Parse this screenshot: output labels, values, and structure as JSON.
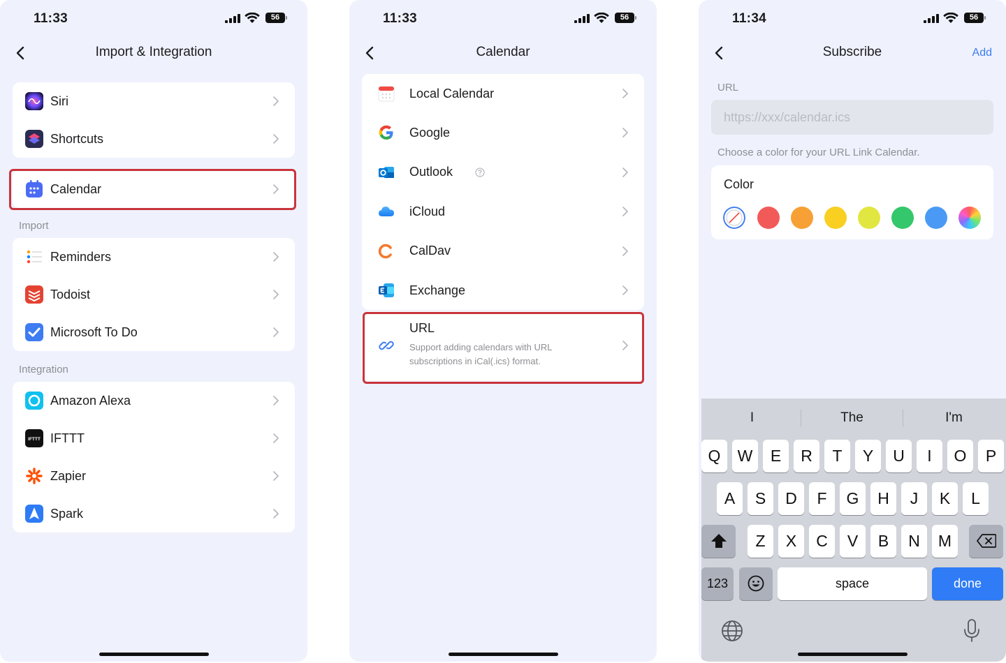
{
  "panel1": {
    "time": "11:33",
    "battery": "56",
    "title": "Import & Integration",
    "group_top": [
      {
        "label": "Siri",
        "icon": "siri-icon"
      },
      {
        "label": "Shortcuts",
        "icon": "shortcuts-icon"
      }
    ],
    "calendar": {
      "label": "Calendar",
      "icon": "calendar-icon"
    },
    "import_header": "Import",
    "import_items": [
      {
        "label": "Reminders",
        "icon": "reminders-icon"
      },
      {
        "label": "Todoist",
        "icon": "todoist-icon"
      },
      {
        "label": "Microsoft To Do",
        "icon": "microsoft-todo-icon"
      }
    ],
    "integration_header": "Integration",
    "integration_items": [
      {
        "label": "Amazon Alexa",
        "icon": "alexa-icon"
      },
      {
        "label": "IFTTT",
        "icon": "ifttt-icon"
      },
      {
        "label": "Zapier",
        "icon": "zapier-icon"
      },
      {
        "label": "Spark",
        "icon": "spark-icon"
      }
    ],
    "ifttt_logo_text": "IFTTT"
  },
  "panel2": {
    "time": "11:33",
    "battery": "56",
    "title": "Calendar",
    "items": [
      {
        "label": "Local Calendar",
        "icon": "local-calendar-icon"
      },
      {
        "label": "Google",
        "icon": "google-icon"
      },
      {
        "label": "Outlook",
        "icon": "outlook-icon"
      },
      {
        "label": "iCloud",
        "icon": "icloud-icon"
      },
      {
        "label": "CalDav",
        "icon": "caldav-icon"
      },
      {
        "label": "Exchange",
        "icon": "exchange-icon"
      }
    ],
    "url_item": {
      "label": "URL",
      "description": "Support adding calendars with URL subscriptions in iCal(.ics) format.",
      "icon": "link-icon"
    }
  },
  "panel3": {
    "time": "11:34",
    "battery": "56",
    "title": "Subscribe",
    "add_label": "Add",
    "url_label": "URL",
    "url_placeholder": "https://xxx/calendar.ics",
    "url_value": "",
    "color_hint": "Choose a color for your URL Link Calendar.",
    "color_label": "Color",
    "colors": [
      "none",
      "#f25a5a",
      "#f7a035",
      "#f9cf22",
      "#e2e640",
      "#34c76b",
      "#4a9af5",
      "rainbow"
    ],
    "keyboard": {
      "suggestions": [
        "I",
        "The",
        "I'm"
      ],
      "row1": [
        "Q",
        "W",
        "E",
        "R",
        "T",
        "Y",
        "U",
        "I",
        "O",
        "P"
      ],
      "row2": [
        "A",
        "S",
        "D",
        "F",
        "G",
        "H",
        "J",
        "K",
        "L"
      ],
      "row3": [
        "Z",
        "X",
        "C",
        "V",
        "B",
        "N",
        "M"
      ],
      "numbers_label": "123",
      "space_label": "space",
      "done_label": "done"
    }
  }
}
